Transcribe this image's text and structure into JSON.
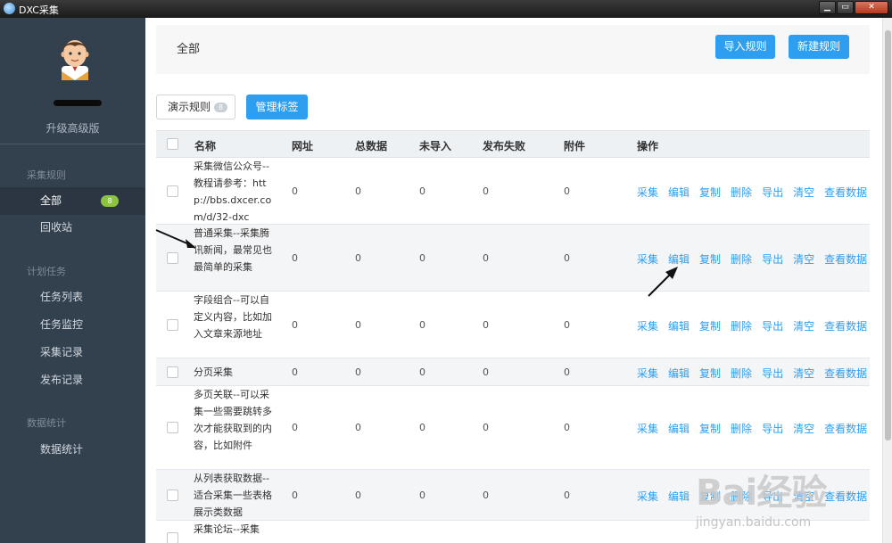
{
  "window": {
    "title": "DXC采集"
  },
  "sidebar": {
    "upgrade": "升级高级版",
    "sections": [
      {
        "title": "采集规则"
      },
      {
        "title": "计划任务"
      },
      {
        "title": "数据统计"
      }
    ],
    "items": [
      {
        "label": "全部",
        "badge": "8",
        "active": true
      },
      {
        "label": "回收站"
      },
      {
        "label": "任务列表"
      },
      {
        "label": "任务监控"
      },
      {
        "label": "采集记录"
      },
      {
        "label": "发布记录"
      },
      {
        "label": "数据统计"
      }
    ]
  },
  "header": {
    "title": "全部",
    "import_label": "导入规则",
    "new_label": "新建规则"
  },
  "toolbar": {
    "demo_label": "演示规则",
    "demo_count": "8",
    "tags_label": "管理标签"
  },
  "table": {
    "columns": [
      "名称",
      "网址",
      "总数据",
      "未导入",
      "发布失败",
      "附件",
      "操作"
    ],
    "actions": [
      "采集",
      "编辑",
      "复制",
      "删除",
      "导出",
      "清空",
      "查看数据"
    ],
    "rows": [
      {
        "name": "采集微信公众号--教程请参考：http://bbs.dxcer.com/d/32-dxc",
        "url": "0",
        "total": "0",
        "unimported": "0",
        "failed": "0",
        "attach": "0"
      },
      {
        "name": "普通采集--采集腾讯新闻，最常见也最简单的采集",
        "url": "0",
        "total": "0",
        "unimported": "0",
        "failed": "0",
        "attach": "0"
      },
      {
        "name": "字段组合--可以自定义内容，比如加入文章来源地址",
        "url": "0",
        "total": "0",
        "unimported": "0",
        "failed": "0",
        "attach": "0"
      },
      {
        "name": "分页采集",
        "url": "0",
        "total": "0",
        "unimported": "0",
        "failed": "0",
        "attach": "0"
      },
      {
        "name": "多页关联--可以采集一些需要跳转多次才能获取到的内容，比如附件",
        "url": "0",
        "total": "0",
        "unimported": "0",
        "failed": "0",
        "attach": "0"
      },
      {
        "name": "从列表获取数据--适合采集一些表格展示类数据",
        "url": "0",
        "total": "0",
        "unimported": "0",
        "failed": "0",
        "attach": "0"
      },
      {
        "name": "采集论坛--采集",
        "url": "",
        "total": "",
        "unimported": "",
        "failed": "",
        "attach": ""
      }
    ]
  },
  "watermark": {
    "main": "Bai经验",
    "sub": "jingyan.baidu.com"
  },
  "colors": {
    "sidebar_bg": "#33404e",
    "accent": "#2d9ef0",
    "badge_green": "#8dc43f"
  },
  "icons": [
    "app-icon",
    "avatar-icon",
    "minimize-icon",
    "maximize-icon",
    "close-icon",
    "arrow-pointer-icon"
  ]
}
